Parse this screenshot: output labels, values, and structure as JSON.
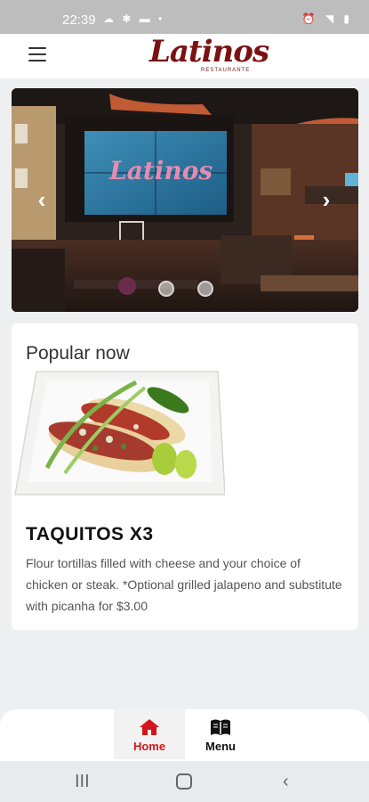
{
  "status_bar": {
    "time": "22:39",
    "left_icons": "☁ ✱ ▬ •",
    "right_icons": "⏰ ◥ ▮"
  },
  "header": {
    "logo_text": "Latinos",
    "logo_subtext": "RESTAURANTE"
  },
  "carousel": {
    "screen_text": "Latinos",
    "slide_count": 2,
    "active_index": 0
  },
  "popular": {
    "heading": "Popular now",
    "item_title": "TAQUITOS X3",
    "item_description": "Flour tortillas filled with cheese and your choice of chicken or steak. *Optional grilled jalapeno and substitute with picanha for $3.00"
  },
  "bottom_nav": {
    "items": [
      {
        "label": "Home",
        "icon": "home-icon",
        "active": true
      },
      {
        "label": "Menu",
        "icon": "menu-book-icon",
        "active": false
      }
    ],
    "active_color": "#d0171d"
  },
  "system_nav": {
    "recents": "III",
    "back": "‹"
  }
}
